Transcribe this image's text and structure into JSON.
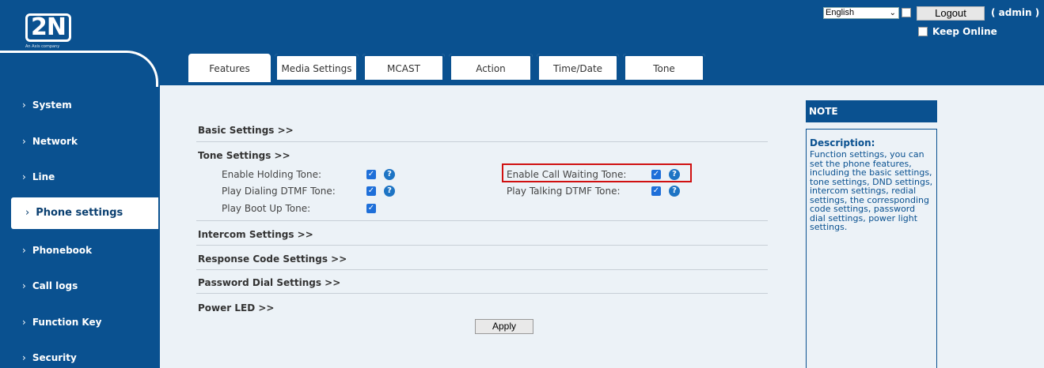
{
  "header": {
    "logo_text": "2N",
    "logo_subtitle": "An Axis company",
    "language": "English",
    "logout_label": "Logout",
    "user_label": "( admin )",
    "keep_online_label": "Keep Online"
  },
  "sidebar": {
    "items": [
      {
        "label": "System"
      },
      {
        "label": "Network"
      },
      {
        "label": "Line"
      },
      {
        "label": "Phone settings",
        "active": true
      },
      {
        "label": "Phonebook"
      },
      {
        "label": "Call logs"
      },
      {
        "label": "Function Key"
      },
      {
        "label": "Security"
      }
    ],
    "chevron": "›"
  },
  "tabs": [
    {
      "label": "Features",
      "active": true
    },
    {
      "label": "Media Settings"
    },
    {
      "label": "MCAST"
    },
    {
      "label": "Action"
    },
    {
      "label": "Time/Date"
    },
    {
      "label": "Tone"
    }
  ],
  "sections": {
    "basic": "Basic Settings >>",
    "tone": "Tone Settings >>",
    "intercom": "Intercom Settings >>",
    "response_code": "Response Code Settings >>",
    "password_dial": "Password Dial Settings >>",
    "power_led": "Power LED >>"
  },
  "tone_fields": {
    "holding": {
      "label": "Enable Holding Tone:",
      "checked": true
    },
    "dialing_dtmf": {
      "label": "Play Dialing DTMF Tone:",
      "checked": true
    },
    "boot_up": {
      "label": "Play Boot Up Tone:",
      "checked": true
    },
    "call_waiting": {
      "label": "Enable Call Waiting Tone:",
      "checked": true
    },
    "talking_dtmf": {
      "label": "Play Talking DTMF Tone:",
      "checked": true
    }
  },
  "apply_label": "Apply",
  "note": {
    "header": "NOTE",
    "title": "Description:",
    "text": "Function settings, you can set the phone features, including the basic settings, tone settings, DND settings, intercom settings, redial settings, the corresponding code settings, password dial settings, power light settings."
  },
  "icons": {
    "check": "✓",
    "help": "?",
    "dropdown": "⌄"
  },
  "colors": {
    "brand_blue": "#0a5190",
    "highlight_red": "#d01010",
    "checkbox_blue": "#1e6fd9"
  }
}
